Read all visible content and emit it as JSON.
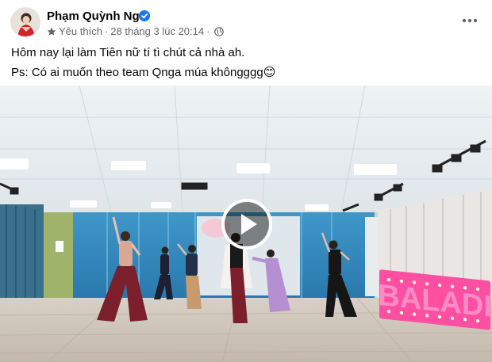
{
  "post": {
    "author": "Phạm Quỳnh Nga",
    "audience_label": "Yêu thích",
    "timestamp": "28 tháng 3 lúc 20:14",
    "separator": "·",
    "text_line1": "Hôm nay lại làm Tiên nữ tí tì chút cả nhà ah.",
    "text_line2": "Ps: Có ai muốn theo team Qnga múa khôngggg😊",
    "accent_color": "#1877f2",
    "meta_color": "#65676b"
  },
  "video": {
    "sign_text": "BALADI",
    "sign_color": "#ff4fa3"
  },
  "icons": {
    "verified": "verified-badge-icon",
    "favorites": "star-icon",
    "privacy": "globe-icon",
    "more": "more-options-icon",
    "play": "play-icon"
  }
}
